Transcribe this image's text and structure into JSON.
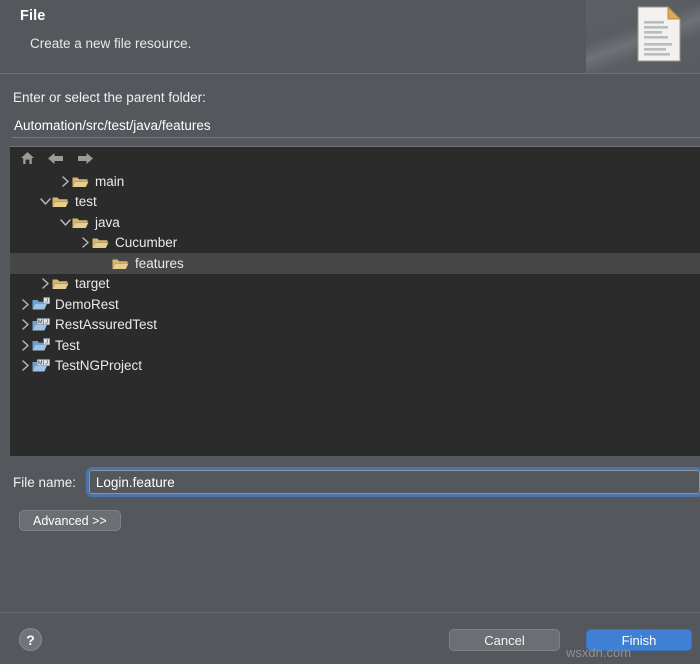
{
  "header": {
    "title": "File",
    "description": "Create a new file resource.",
    "icon": "new-file-document-icon"
  },
  "parent_folder": {
    "label": "Enter or select the parent folder:",
    "value": "Automation/src/test/java/features",
    "placeholder": ""
  },
  "tree_toolbar": {
    "home_icon": "home-icon",
    "back_icon": "back-arrow-icon",
    "forward_icon": "forward-arrow-icon"
  },
  "tree": {
    "rows": [
      {
        "label": "main",
        "indent": 3,
        "twisty": "collapsed",
        "icon": "folder-icon",
        "selected": false
      },
      {
        "label": "test",
        "indent": 2,
        "twisty": "expanded",
        "icon": "folder-icon",
        "selected": false
      },
      {
        "label": "java",
        "indent": 3,
        "twisty": "expanded",
        "icon": "folder-icon",
        "selected": false
      },
      {
        "label": "Cucumber",
        "indent": 4,
        "twisty": "collapsed",
        "icon": "folder-icon",
        "selected": false
      },
      {
        "label": "features",
        "indent": 5,
        "twisty": "none",
        "icon": "folder-icon",
        "selected": true
      },
      {
        "label": "target",
        "indent": 2,
        "twisty": "collapsed",
        "icon": "folder-icon",
        "selected": false
      },
      {
        "label": "DemoRest",
        "indent": 1,
        "twisty": "collapsed",
        "icon": "java-project-icon",
        "selected": false
      },
      {
        "label": "RestAssuredTest",
        "indent": 1,
        "twisty": "collapsed",
        "icon": "maven-project-icon",
        "selected": false
      },
      {
        "label": "Test",
        "indent": 1,
        "twisty": "collapsed",
        "icon": "java-project-icon",
        "selected": false
      },
      {
        "label": "TestNGProject",
        "indent": 1,
        "twisty": "collapsed",
        "icon": "maven-project-icon",
        "selected": false
      }
    ]
  },
  "file_name": {
    "label": "File name:",
    "value": "Login.feature",
    "placeholder": ""
  },
  "advanced": {
    "label": "Advanced >>"
  },
  "footer": {
    "help_label": "?",
    "cancel_label": "Cancel",
    "finish_label": "Finish"
  },
  "watermark": {
    "text": "wsxdn.com"
  },
  "colors": {
    "dialog_bg": "#54585c",
    "tree_bg": "#2b2b2b",
    "selection": "#474747",
    "accent_blue": "#3f7fd4",
    "folder_gold": "#d8b66a",
    "focus_ring": "#4a7ec6"
  }
}
